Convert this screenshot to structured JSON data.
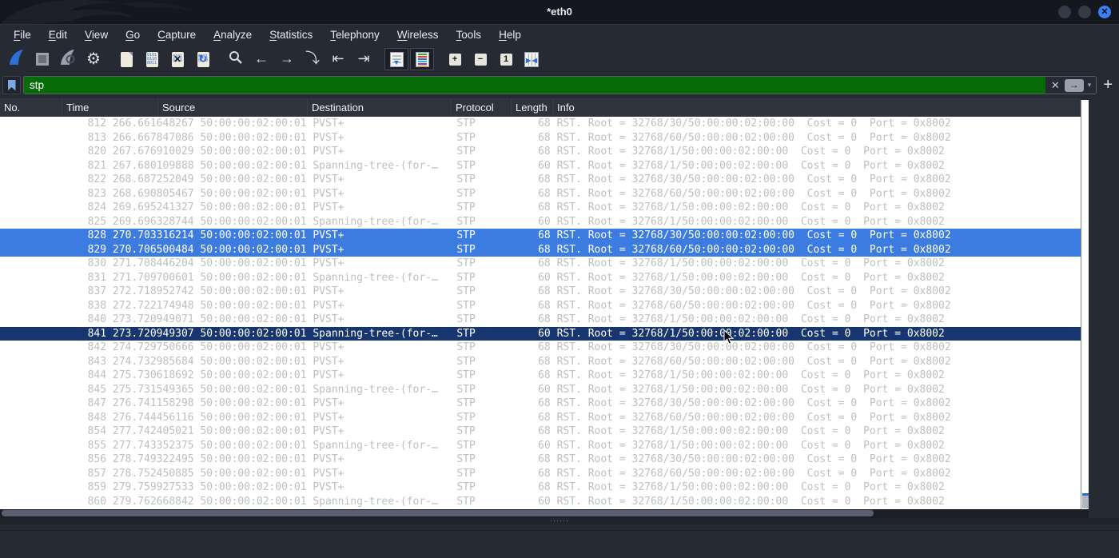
{
  "window": {
    "title": "*eth0"
  },
  "menu": {
    "items": [
      {
        "label": "File"
      },
      {
        "label": "Edit"
      },
      {
        "label": "View"
      },
      {
        "label": "Go"
      },
      {
        "label": "Capture"
      },
      {
        "label": "Analyze"
      },
      {
        "label": "Statistics"
      },
      {
        "label": "Telephony"
      },
      {
        "label": "Wireless"
      },
      {
        "label": "Tools"
      },
      {
        "label": "Help"
      }
    ]
  },
  "toolbar": {
    "icons": [
      {
        "name": "start-capture",
        "group": 1,
        "pressed": false
      },
      {
        "name": "stop-capture",
        "group": 1,
        "pressed": false
      },
      {
        "name": "restart-capture",
        "group": 1,
        "pressed": false
      },
      {
        "name": "capture-options",
        "group": 1,
        "pressed": false
      },
      {
        "name": "open-file",
        "group": 2,
        "pressed": false
      },
      {
        "name": "save-file",
        "group": 2,
        "pressed": false
      },
      {
        "name": "close-file",
        "group": 2,
        "pressed": false
      },
      {
        "name": "reload-file",
        "group": 2,
        "pressed": false
      },
      {
        "name": "find-packet",
        "group": 3,
        "pressed": false
      },
      {
        "name": "go-back",
        "group": 3,
        "pressed": false
      },
      {
        "name": "go-forward",
        "group": 3,
        "pressed": false
      },
      {
        "name": "go-to-packet",
        "group": 3,
        "pressed": false
      },
      {
        "name": "go-first-packet",
        "group": 3,
        "pressed": false
      },
      {
        "name": "go-last-packet",
        "group": 3,
        "pressed": false
      },
      {
        "name": "auto-scroll",
        "group": 4,
        "pressed": true
      },
      {
        "name": "colorize-packets",
        "group": 4,
        "pressed": true
      },
      {
        "name": "zoom-in",
        "group": 5,
        "pressed": false
      },
      {
        "name": "zoom-out",
        "group": 5,
        "pressed": false
      },
      {
        "name": "normal-size",
        "group": 5,
        "pressed": false
      },
      {
        "name": "resize-columns",
        "group": 5,
        "pressed": false
      }
    ]
  },
  "filter": {
    "value": "stp",
    "clear_icon": "✕",
    "apply_icon": "→",
    "caret_icon": "▾",
    "add_label": "+"
  },
  "packet_list": {
    "columns": [
      "No.",
      "Time",
      "Source",
      "Destination",
      "Protocol",
      "Length",
      "Info"
    ],
    "rows": [
      {
        "no": "812",
        "time": "266.661648267",
        "source": "50:00:00:02:00:01",
        "destination": "PVST+",
        "protocol": "STP",
        "length": "68",
        "info": "RST. Root = 32768/30/50:00:00:02:00:00  Cost = 0  Port = 0x8002",
        "state": "normal"
      },
      {
        "no": "813",
        "time": "266.667847086",
        "source": "50:00:00:02:00:01",
        "destination": "PVST+",
        "protocol": "STP",
        "length": "68",
        "info": "RST. Root = 32768/60/50:00:00:02:00:00  Cost = 0  Port = 0x8002",
        "state": "normal"
      },
      {
        "no": "820",
        "time": "267.676910029",
        "source": "50:00:00:02:00:01",
        "destination": "PVST+",
        "protocol": "STP",
        "length": "68",
        "info": "RST. Root = 32768/1/50:00:00:02:00:00  Cost = 0  Port = 0x8002",
        "state": "normal"
      },
      {
        "no": "821",
        "time": "267.680109888",
        "source": "50:00:00:02:00:01",
        "destination": "Spanning-tree-(for-…",
        "protocol": "STP",
        "length": "60",
        "info": "RST. Root = 32768/1/50:00:00:02:00:00  Cost = 0  Port = 0x8002",
        "state": "normal"
      },
      {
        "no": "822",
        "time": "268.687252049",
        "source": "50:00:00:02:00:01",
        "destination": "PVST+",
        "protocol": "STP",
        "length": "68",
        "info": "RST. Root = 32768/30/50:00:00:02:00:00  Cost = 0  Port = 0x8002",
        "state": "normal"
      },
      {
        "no": "823",
        "time": "268.690805467",
        "source": "50:00:00:02:00:01",
        "destination": "PVST+",
        "protocol": "STP",
        "length": "68",
        "info": "RST. Root = 32768/60/50:00:00:02:00:00  Cost = 0  Port = 0x8002",
        "state": "normal"
      },
      {
        "no": "824",
        "time": "269.695241327",
        "source": "50:00:00:02:00:01",
        "destination": "PVST+",
        "protocol": "STP",
        "length": "68",
        "info": "RST. Root = 32768/1/50:00:00:02:00:00  Cost = 0  Port = 0x8002",
        "state": "normal"
      },
      {
        "no": "825",
        "time": "269.696328744",
        "source": "50:00:00:02:00:01",
        "destination": "Spanning-tree-(for-…",
        "protocol": "STP",
        "length": "60",
        "info": "RST. Root = 32768/1/50:00:00:02:00:00  Cost = 0  Port = 0x8002",
        "state": "normal"
      },
      {
        "no": "828",
        "time": "270.703316214",
        "source": "50:00:00:02:00:01",
        "destination": "PVST+",
        "protocol": "STP",
        "length": "68",
        "info": "RST. Root = 32768/30/50:00:00:02:00:00  Cost = 0  Port = 0x8002",
        "state": "selected"
      },
      {
        "no": "829",
        "time": "270.706500484",
        "source": "50:00:00:02:00:01",
        "destination": "PVST+",
        "protocol": "STP",
        "length": "68",
        "info": "RST. Root = 32768/60/50:00:00:02:00:00  Cost = 0  Port = 0x8002",
        "state": "selected"
      },
      {
        "no": "830",
        "time": "271.708446204",
        "source": "50:00:00:02:00:01",
        "destination": "PVST+",
        "protocol": "STP",
        "length": "68",
        "info": "RST. Root = 32768/1/50:00:00:02:00:00  Cost = 0  Port = 0x8002",
        "state": "normal"
      },
      {
        "no": "831",
        "time": "271.709700601",
        "source": "50:00:00:02:00:01",
        "destination": "Spanning-tree-(for-…",
        "protocol": "STP",
        "length": "60",
        "info": "RST. Root = 32768/1/50:00:00:02:00:00  Cost = 0  Port = 0x8002",
        "state": "normal"
      },
      {
        "no": "837",
        "time": "272.718952742",
        "source": "50:00:00:02:00:01",
        "destination": "PVST+",
        "protocol": "STP",
        "length": "68",
        "info": "RST. Root = 32768/30/50:00:00:02:00:00  Cost = 0  Port = 0x8002",
        "state": "normal"
      },
      {
        "no": "838",
        "time": "272.722174948",
        "source": "50:00:00:02:00:01",
        "destination": "PVST+",
        "protocol": "STP",
        "length": "68",
        "info": "RST. Root = 32768/60/50:00:00:02:00:00  Cost = 0  Port = 0x8002",
        "state": "normal"
      },
      {
        "no": "840",
        "time": "273.720949071",
        "source": "50:00:00:02:00:01",
        "destination": "PVST+",
        "protocol": "STP",
        "length": "68",
        "info": "RST. Root = 32768/1/50:00:00:02:00:00  Cost = 0  Port = 0x8002",
        "state": "normal"
      },
      {
        "no": "841",
        "time": "273.720949307",
        "source": "50:00:00:02:00:01",
        "destination": "Spanning-tree-(for-…",
        "protocol": "STP",
        "length": "60",
        "info": "RST. Root = 32768/1/50:00:00:02:00:00  Cost = 0  Port = 0x8002",
        "state": "focused"
      },
      {
        "no": "842",
        "time": "274.729750666",
        "source": "50:00:00:02:00:01",
        "destination": "PVST+",
        "protocol": "STP",
        "length": "68",
        "info": "RST. Root = 32768/30/50:00:00:02:00:00  Cost = 0  Port = 0x8002",
        "state": "normal"
      },
      {
        "no": "843",
        "time": "274.732985684",
        "source": "50:00:00:02:00:01",
        "destination": "PVST+",
        "protocol": "STP",
        "length": "68",
        "info": "RST. Root = 32768/60/50:00:00:02:00:00  Cost = 0  Port = 0x8002",
        "state": "normal"
      },
      {
        "no": "844",
        "time": "275.730618692",
        "source": "50:00:00:02:00:01",
        "destination": "PVST+",
        "protocol": "STP",
        "length": "68",
        "info": "RST. Root = 32768/1/50:00:00:02:00:00  Cost = 0  Port = 0x8002",
        "state": "normal"
      },
      {
        "no": "845",
        "time": "275.731549365",
        "source": "50:00:00:02:00:01",
        "destination": "Spanning-tree-(for-…",
        "protocol": "STP",
        "length": "60",
        "info": "RST. Root = 32768/1/50:00:00:02:00:00  Cost = 0  Port = 0x8002",
        "state": "normal"
      },
      {
        "no": "847",
        "time": "276.741158298",
        "source": "50:00:00:02:00:01",
        "destination": "PVST+",
        "protocol": "STP",
        "length": "68",
        "info": "RST. Root = 32768/30/50:00:00:02:00:00  Cost = 0  Port = 0x8002",
        "state": "normal"
      },
      {
        "no": "848",
        "time": "276.744456116",
        "source": "50:00:00:02:00:01",
        "destination": "PVST+",
        "protocol": "STP",
        "length": "68",
        "info": "RST. Root = 32768/60/50:00:00:02:00:00  Cost = 0  Port = 0x8002",
        "state": "normal"
      },
      {
        "no": "854",
        "time": "277.742405021",
        "source": "50:00:00:02:00:01",
        "destination": "PVST+",
        "protocol": "STP",
        "length": "68",
        "info": "RST. Root = 32768/1/50:00:00:02:00:00  Cost = 0  Port = 0x8002",
        "state": "normal"
      },
      {
        "no": "855",
        "time": "277.743352375",
        "source": "50:00:00:02:00:01",
        "destination": "Spanning-tree-(for-…",
        "protocol": "STP",
        "length": "60",
        "info": "RST. Root = 32768/1/50:00:00:02:00:00  Cost = 0  Port = 0x8002",
        "state": "normal"
      },
      {
        "no": "856",
        "time": "278.749322495",
        "source": "50:00:00:02:00:01",
        "destination": "PVST+",
        "protocol": "STP",
        "length": "68",
        "info": "RST. Root = 32768/30/50:00:00:02:00:00  Cost = 0  Port = 0x8002",
        "state": "normal"
      },
      {
        "no": "857",
        "time": "278.752450885",
        "source": "50:00:00:02:00:01",
        "destination": "PVST+",
        "protocol": "STP",
        "length": "68",
        "info": "RST. Root = 32768/60/50:00:00:02:00:00  Cost = 0  Port = 0x8002",
        "state": "normal"
      },
      {
        "no": "859",
        "time": "279.759927533",
        "source": "50:00:00:02:00:01",
        "destination": "PVST+",
        "protocol": "STP",
        "length": "68",
        "info": "RST. Root = 32768/1/50:00:00:02:00:00  Cost = 0  Port = 0x8002",
        "state": "normal"
      },
      {
        "no": "860",
        "time": "279.762668842",
        "source": "50:00:00:02:00:01",
        "destination": "Spanning-tree-(for-…",
        "protocol": "STP",
        "length": "60",
        "info": "RST. Root = 32768/1/50:00:00:02:00:00  Cost = 0  Port = 0x8002",
        "state": "normal"
      }
    ]
  },
  "colors": {
    "filter_valid_background": "#076c07",
    "selection_blue": "#3c7be0",
    "focused_navy": "#17366f",
    "row_text_gray": "#bdc0bd",
    "titlebar_background": "#14171e",
    "chrome_background": "#262a33",
    "close_button_blue": "#3b7ff0"
  }
}
